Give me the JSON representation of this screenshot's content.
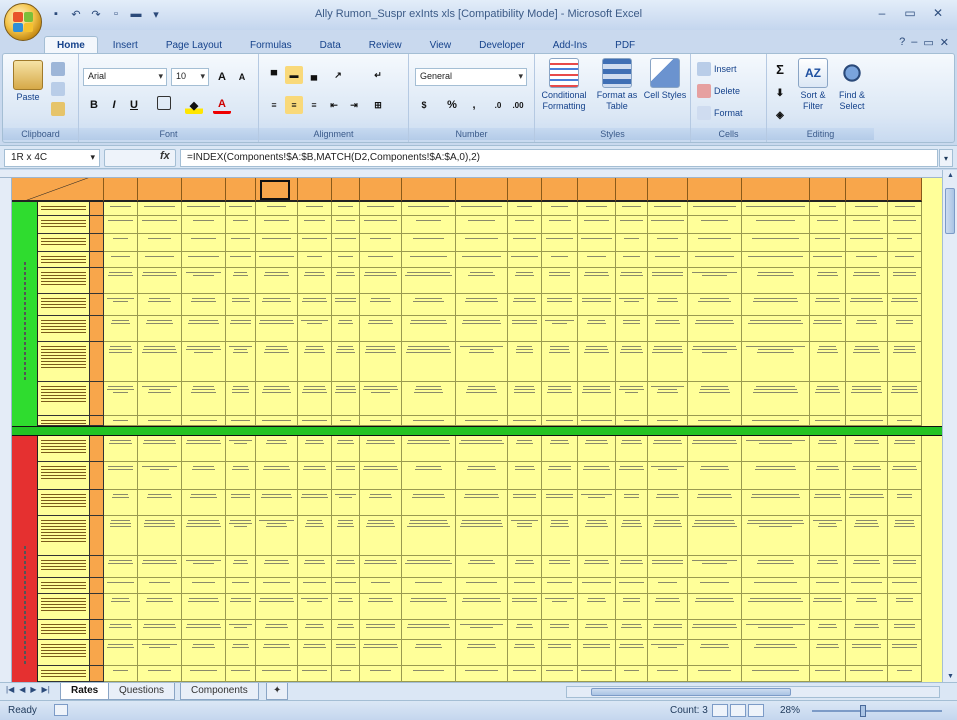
{
  "app": {
    "window_title": "Ally Rumon_Suspr exInts xls  [Compatibility Mode] - Microsoft Excel"
  },
  "ribbon": {
    "tabs": [
      "Home",
      "Insert",
      "Page Layout",
      "Formulas",
      "Data",
      "Review",
      "View",
      "Developer",
      "Add-Ins",
      "PDF"
    ],
    "active_tab": "Home",
    "clipboard": {
      "paste_label": "Paste",
      "group_label": "Clipboard"
    },
    "font": {
      "name": "Arial",
      "size": "10",
      "group_label": "Font",
      "bold": "B",
      "italic": "I",
      "underline": "U"
    },
    "alignment": {
      "group_label": "Alignment"
    },
    "number": {
      "format": "General",
      "group_label": "Number",
      "percent": "%",
      "comma": ","
    },
    "styles": {
      "conditional_formatting": "Conditional Formatting",
      "format_as_table": "Format as Table",
      "cell_styles": "Cell Styles",
      "group_label": "Styles"
    },
    "cells": {
      "insert": "Insert",
      "delete": "Delete",
      "format": "Format",
      "group_label": "Cells"
    },
    "editing": {
      "sort_filter": "Sort & Filter",
      "find_select": "Find & Select",
      "group_label": "Editing"
    }
  },
  "formula_bar": {
    "name_box": "1R x 4C",
    "fx": "fx",
    "formula": "=INDEX(Components!$A:$B,MATCH(D2,Components!$A:$A,0),2)"
  },
  "sheets": {
    "tabs": [
      "Rates",
      "Questions",
      "Components"
    ],
    "active": "Rates"
  },
  "status": {
    "ready": "Ready",
    "count": "Count: 3",
    "zoom": "28%"
  },
  "colors": {
    "header_orange": "#f8a64b",
    "cell_yellow": "#ffff99",
    "band_green": "#2fdc2f",
    "band_red": "#e53030"
  }
}
